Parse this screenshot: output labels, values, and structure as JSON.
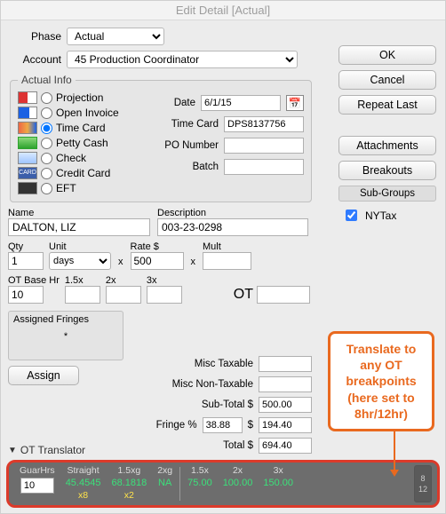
{
  "window": {
    "title": "Edit Detail [Actual]"
  },
  "phase": {
    "label": "Phase",
    "value": "Actual"
  },
  "account": {
    "label": "Account",
    "value": "45 Production Coordinator"
  },
  "side_buttons": {
    "ok": "OK",
    "cancel": "Cancel",
    "repeat": "Repeat Last",
    "attachments": "Attachments",
    "breakouts": "Breakouts",
    "subgroups_label": "Sub-Groups",
    "subgroups": [
      {
        "label": "NYTax",
        "checked": true
      }
    ]
  },
  "actual_info": {
    "legend": "Actual Info",
    "options": [
      {
        "key": "projection",
        "label": "Projection"
      },
      {
        "key": "open_invoice",
        "label": "Open Invoice"
      },
      {
        "key": "time_card",
        "label": "Time Card",
        "selected": true
      },
      {
        "key": "petty_cash",
        "label": "Petty Cash"
      },
      {
        "key": "check",
        "label": "Check"
      },
      {
        "key": "credit_card",
        "label": "Credit Card"
      },
      {
        "key": "eft",
        "label": "EFT"
      }
    ],
    "date": {
      "label": "Date",
      "value": "6/1/15"
    },
    "timecard": {
      "label": "Time Card",
      "value": "DPS8137756"
    },
    "po": {
      "label": "PO Number",
      "value": ""
    },
    "batch": {
      "label": "Batch",
      "value": ""
    }
  },
  "name": {
    "label": "Name",
    "value": "DALTON, LIZ"
  },
  "desc": {
    "label": "Description",
    "value": "003-23-0298"
  },
  "qty": {
    "label": "Qty",
    "value": "1"
  },
  "unit": {
    "label": "Unit",
    "value": "days"
  },
  "rate": {
    "label": "Rate $",
    "value": "500"
  },
  "mult": {
    "label": "Mult",
    "value": ""
  },
  "x_sym": "x",
  "ot_base": {
    "label": "OT Base Hr",
    "value": "10"
  },
  "ot_15": {
    "label": "1.5x",
    "value": ""
  },
  "ot_2": {
    "label": "2x",
    "value": ""
  },
  "ot_3": {
    "label": "3x",
    "value": ""
  },
  "ot_field": {
    "label": "OT",
    "value": ""
  },
  "fringes": {
    "legend": "Assigned Fringes",
    "body": "*",
    "assign": "Assign"
  },
  "totals": {
    "misc_tax": {
      "label": "Misc Taxable",
      "value": ""
    },
    "misc_nontax": {
      "label": "Misc Non-Taxable",
      "value": ""
    },
    "subtotal": {
      "label": "Sub-Total $",
      "value": "500.00"
    },
    "fringe_pct": {
      "label": "Fringe %",
      "pct": "38.88",
      "money_label": "$",
      "money": "194.40"
    },
    "total": {
      "label": "Total $",
      "value": "694.40"
    }
  },
  "ot_translator": {
    "header": "OT Translator",
    "guarhrs": {
      "label": "GuarHrs",
      "value": "10"
    },
    "straight": {
      "label": "Straight",
      "value": "45.4545",
      "sub": "x8"
    },
    "xg15": {
      "label": "1.5xg",
      "value": "68.1818",
      "sub": "x2"
    },
    "xg2": {
      "label": "2xg",
      "value": "NA"
    },
    "x15": {
      "label": "1.5x",
      "value": "75.00"
    },
    "x2": {
      "label": "2x",
      "value": "100.00"
    },
    "x3": {
      "label": "3x",
      "value": "150.00"
    },
    "end_top": "8",
    "end_bot": "12"
  },
  "callout": {
    "line1": "Translate to",
    "line2": "any OT",
    "line3": "breakpoints",
    "line4": "(here set to",
    "line5": "8hr/12hr)"
  }
}
